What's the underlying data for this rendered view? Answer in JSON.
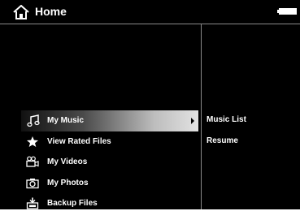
{
  "header": {
    "title": "Home",
    "home_icon": "home-icon",
    "battery_icon": "battery-icon"
  },
  "menu": {
    "items": [
      {
        "label": "My Music",
        "icon": "music-note-icon",
        "selected": true
      },
      {
        "label": "View Rated Files",
        "icon": "star-icon",
        "selected": false
      },
      {
        "label": "My Videos",
        "icon": "video-camera-icon",
        "selected": false
      },
      {
        "label": "My Photos",
        "icon": "camera-icon",
        "selected": false
      },
      {
        "label": "Backup Files",
        "icon": "backup-icon",
        "selected": false
      }
    ]
  },
  "submenu": {
    "items": [
      {
        "label": "Music List"
      },
      {
        "label": "Resume"
      }
    ]
  },
  "colors": {
    "background": "#000000",
    "text": "#ffffff",
    "divider": "#8a8a8a",
    "highlight_end": "#e2e2e2"
  }
}
